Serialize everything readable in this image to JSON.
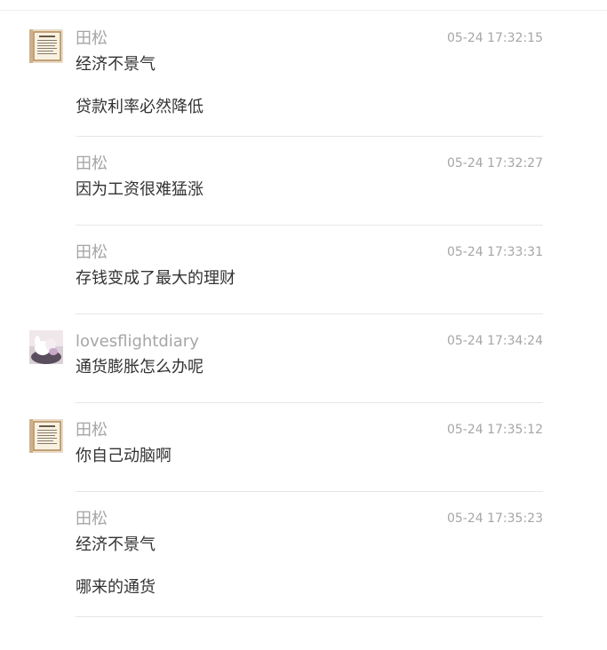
{
  "messages": [
    {
      "avatar": "book-avatar",
      "author": "田松",
      "time": "05-24 17:32:15",
      "lines": [
        "经济不景气",
        "贷款利率必然降低"
      ]
    },
    {
      "avatar": "",
      "author": "田松",
      "time": "05-24 17:32:27",
      "lines": [
        "因为工资很难猛涨"
      ]
    },
    {
      "avatar": "",
      "author": "田松",
      "time": "05-24 17:33:31",
      "lines": [
        "存钱变成了最大的理财"
      ]
    },
    {
      "avatar": "figurine-avatar",
      "author": "lovesflightdiary",
      "time": "05-24 17:34:24",
      "lines": [
        "通货膨胀怎么办呢"
      ]
    },
    {
      "avatar": "book-avatar",
      "author": "田松",
      "time": "05-24 17:35:12",
      "lines": [
        "你自己动脑啊"
      ]
    },
    {
      "avatar": "",
      "author": "田松",
      "time": "05-24 17:35:23",
      "lines": [
        "经济不景气",
        "哪来的通货"
      ]
    }
  ]
}
